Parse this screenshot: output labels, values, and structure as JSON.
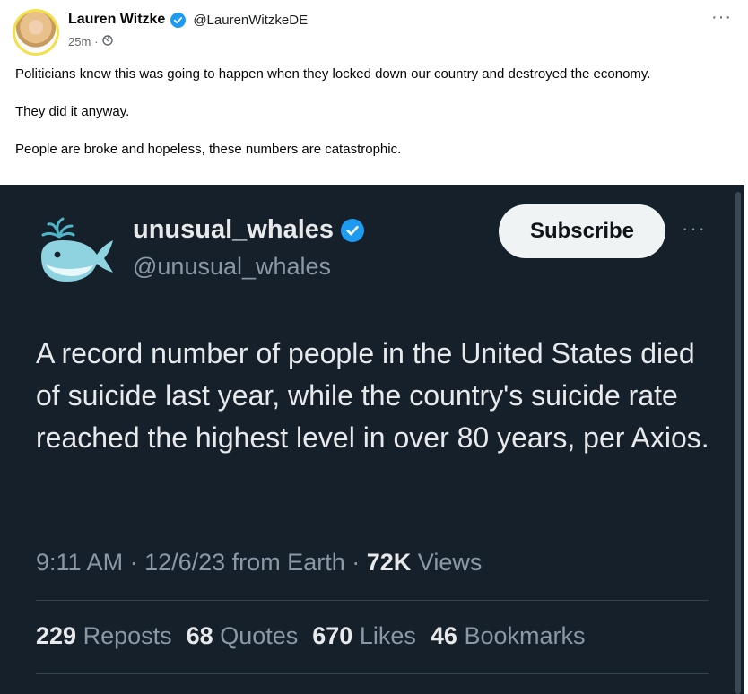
{
  "post": {
    "author_name": "Lauren Witzke",
    "author_handle": "@LaurenWitzkeDE",
    "timestamp": "25m",
    "separator": "·",
    "text": [
      "Politicians knew this was going to happen when they locked down our country and destroyed the economy.",
      "They did it anyway.",
      "People are broke and hopeless, these numbers are catastrophic."
    ]
  },
  "tweet": {
    "name": "unusual_whales",
    "handle": "@unusual_whales",
    "subscribe_label": "Subscribe",
    "body": "A record number of people in the United States died of suicide last year, while the country's suicide rate reached the highest level in over 80 years, per Axios.",
    "time": "9:11 AM",
    "sep1": "·",
    "date": "12/6/23 from Earth",
    "sep2": "·",
    "views_count": "72K",
    "views_label": "Views",
    "reposts_count": "229",
    "reposts_label": "Reposts",
    "quotes_count": "68",
    "quotes_label": "Quotes",
    "likes_count": "670",
    "likes_label": "Likes",
    "bookmarks_count": "46",
    "bookmarks_label": "Bookmarks"
  },
  "icons": {
    "verified": "verified-badge-icon",
    "audience": "globe-icon",
    "more": "more-options-icon",
    "logo": "whale-logo-icon"
  },
  "colors": {
    "verified_blue": "#1d9bf0",
    "embed_background": "#15202b",
    "avatar_ring": "#f3e04a"
  }
}
